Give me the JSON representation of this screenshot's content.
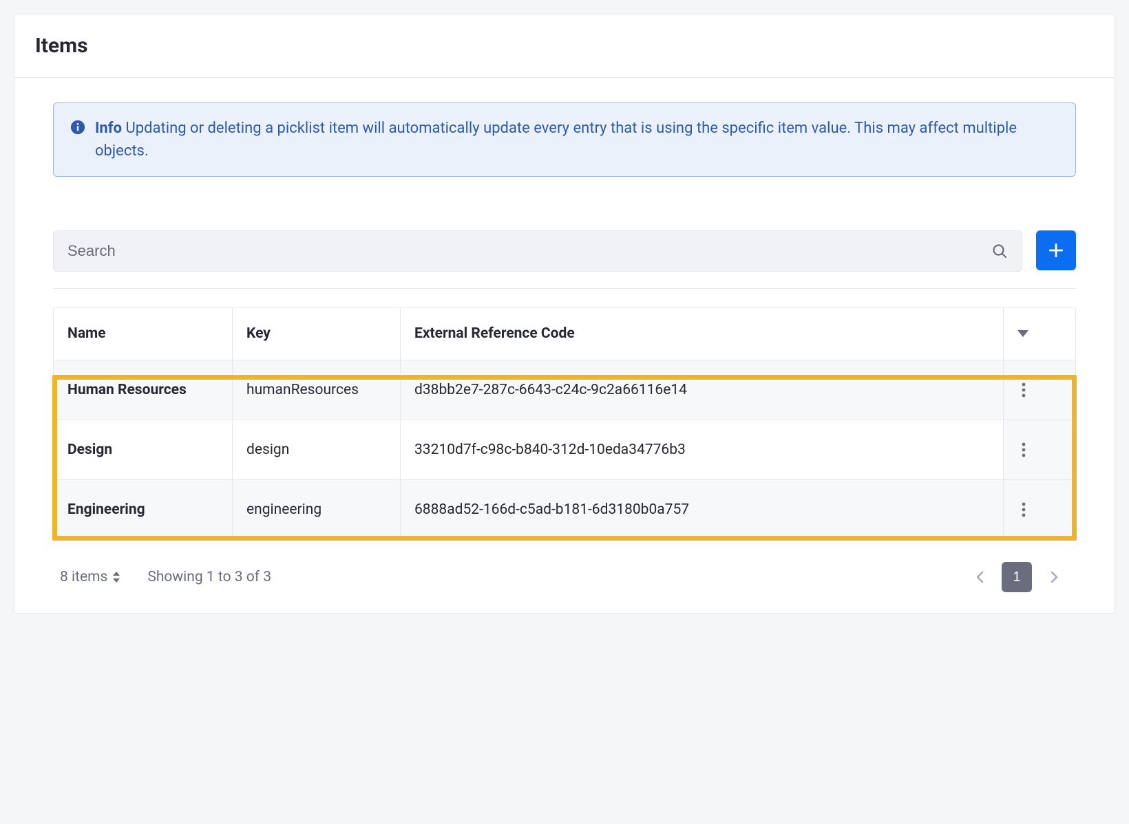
{
  "header": {
    "title": "Items"
  },
  "alert": {
    "label": "Info",
    "message": "Updating or deleting a picklist item will automatically update every entry that is using the specific item value. This may affect multiple objects."
  },
  "search": {
    "placeholder": "Search"
  },
  "table": {
    "columns": {
      "name": "Name",
      "key": "Key",
      "erc": "External Reference Code"
    },
    "rows": [
      {
        "name": "Human Resources",
        "key": "humanResources",
        "erc": "d38bb2e7-287c-6643-c24c-9c2a66116e14"
      },
      {
        "name": "Design",
        "key": "design",
        "erc": "33210d7f-c98c-b840-312d-10eda34776b3"
      },
      {
        "name": "Engineering",
        "key": "engineering",
        "erc": "6888ad52-166d-c5ad-b181-6d3180b0a757"
      }
    ]
  },
  "footer": {
    "items_count": "8 items",
    "showing": "Showing 1 to 3 of 3",
    "current_page": "1"
  }
}
